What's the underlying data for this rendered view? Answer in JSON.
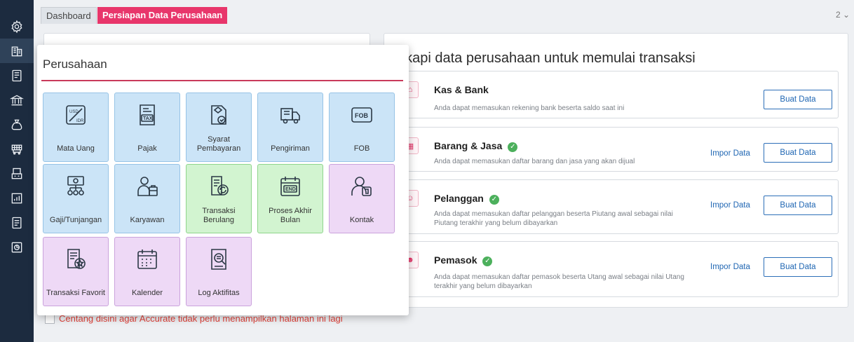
{
  "sidebar": {
    "icons": [
      "gear-icon",
      "building-icon",
      "ledger-icon",
      "bank-icon",
      "money-bag-icon",
      "cart-icon",
      "cashier-icon",
      "report-icon",
      "tax-icon",
      "chart-icon"
    ]
  },
  "tabs": {
    "dashboard": "Dashboard",
    "active": "Persiapan Data Perusahaan",
    "count": "2 ⌄"
  },
  "right_panel": {
    "title": "gkapi data perusahaan untuk memulai transaksi",
    "cards": [
      {
        "title": "Kas & Bank",
        "verified": false,
        "desc": "Anda dapat memasukan rekening bank beserta saldo saat ini",
        "impor": "",
        "button": "Buat Data"
      },
      {
        "title": "Barang & Jasa",
        "verified": true,
        "desc": "Anda dapat memasukan daftar barang dan jasa yang akan dijual",
        "impor": "Impor Data",
        "button": "Buat Data"
      },
      {
        "title": "Pelanggan",
        "verified": true,
        "desc": "Anda dapat memasukan daftar pelanggan beserta Piutang awal sebagai nilai Piutang terakhir yang belum dibayarkan",
        "impor": "Impor Data",
        "button": "Buat Data"
      },
      {
        "title": "Pemasok",
        "verified": true,
        "desc": "Anda dapat memasukan daftar pemasok beserta Utang awal sebagai nilai Utang terakhir yang belum dibayarkan",
        "impor": "Impor Data",
        "button": "Buat Data"
      }
    ]
  },
  "footer": {
    "checkbox_label": "Centang disini agar Accurate tidak perlu menampilkan halaman ini lagi"
  },
  "popup": {
    "title": "Perusahaan",
    "tiles": [
      {
        "label": "Mata Uang",
        "icon": "currency-icon",
        "color": "blue"
      },
      {
        "label": "Pajak",
        "icon": "tax-icon",
        "color": "blue"
      },
      {
        "label": "Syarat Pembayaran",
        "icon": "payment-terms-icon",
        "color": "blue"
      },
      {
        "label": "Pengiriman",
        "icon": "truck-icon",
        "color": "blue"
      },
      {
        "label": "FOB",
        "icon": "fob-icon",
        "color": "blue"
      },
      {
        "label": "Gaji/Tunjangan",
        "icon": "salary-icon",
        "color": "blue"
      },
      {
        "label": "Karyawan",
        "icon": "employee-icon",
        "color": "blue"
      },
      {
        "label": "Transaksi Berulang",
        "icon": "recurring-icon",
        "color": "green"
      },
      {
        "label": "Proses Akhir Bulan",
        "icon": "calendar-end-icon",
        "color": "green"
      },
      {
        "label": "Kontak",
        "icon": "contact-icon",
        "color": "purple"
      },
      {
        "label": "Transaksi Favorit",
        "icon": "favorite-icon",
        "color": "purple"
      },
      {
        "label": "Kalender",
        "icon": "calendar-icon",
        "color": "purple"
      },
      {
        "label": "Log Aktifitas",
        "icon": "activity-log-icon",
        "color": "purple"
      }
    ]
  }
}
